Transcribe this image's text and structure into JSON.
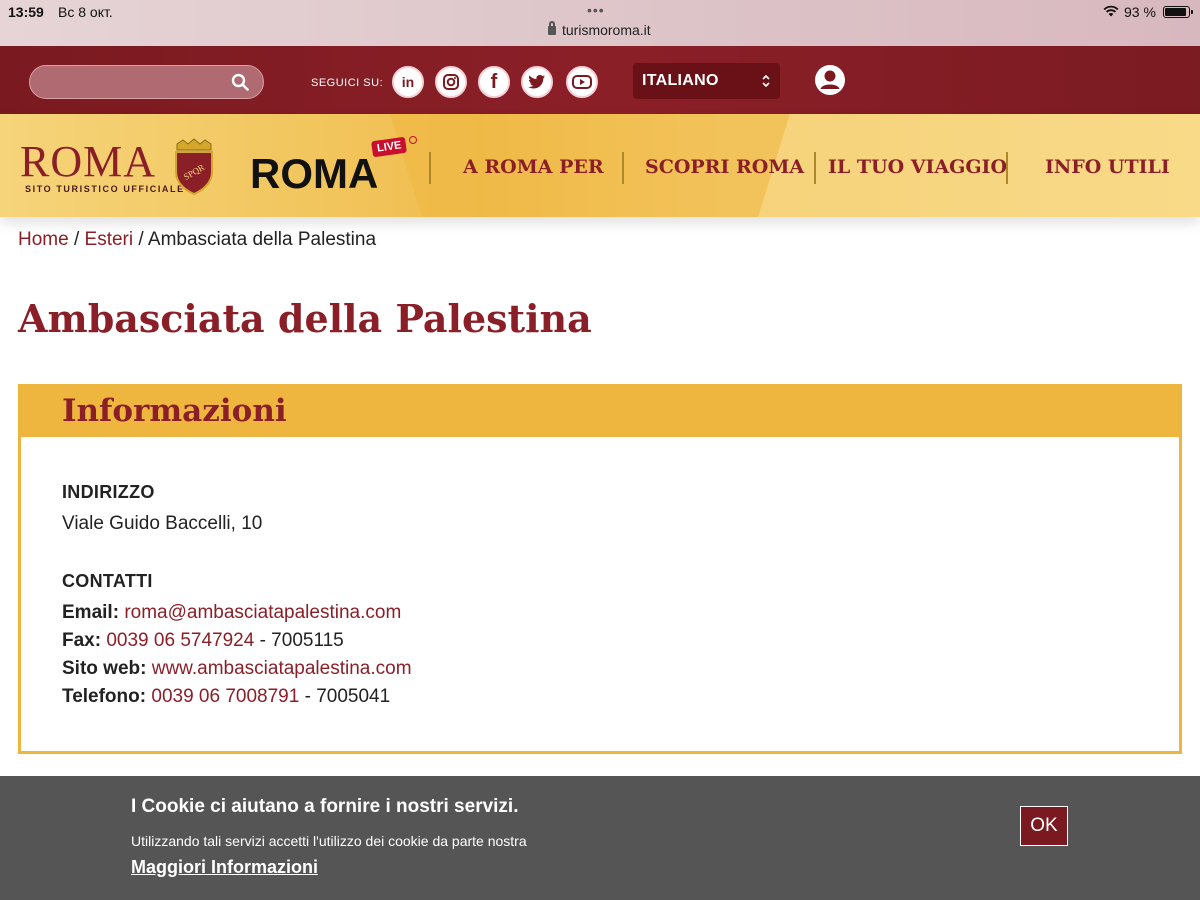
{
  "status_bar": {
    "time": "13:59",
    "date": "Вс 8 окт.",
    "url": "turismoroma.it",
    "battery": "93 %"
  },
  "topbar": {
    "follow_label": "SEGUICI SU:",
    "social": [
      {
        "name": "linkedin-icon",
        "glyph": "in"
      },
      {
        "name": "instagram-icon",
        "glyph": "◎"
      },
      {
        "name": "facebook-icon",
        "glyph": "f"
      },
      {
        "name": "twitter-icon",
        "glyph": "🐦"
      },
      {
        "name": "youtube-icon",
        "glyph": "▶"
      }
    ],
    "language": "ITALIANO"
  },
  "navbar": {
    "logo_text": "ROMA",
    "logo_subtitle": "SITO TURISTICO UFFICIALE",
    "roma_live": "ROMA",
    "live_badge": "LIVE",
    "items": [
      "A ROMA PER",
      "SCOPRI ROMA",
      "IL TUO VIAGGIO",
      "INFO UTILI"
    ]
  },
  "breadcrumb": {
    "home": "Home",
    "sep1": " / ",
    "section": "Esteri",
    "sep2": " / ",
    "current": "Ambasciata della Palestina"
  },
  "page": {
    "title": "Ambasciata della Palestina"
  },
  "info": {
    "heading": "Informazioni",
    "address_label": "INDIRIZZO",
    "address": "Viale Guido Baccelli, 10",
    "contacts_label": "CONTATTI",
    "email_label": "Email:",
    "email": "roma@ambasciatapalestina.com",
    "fax_label": "Fax:",
    "fax": "0039 06 5747924",
    "fax_extra": " - 7005115",
    "web_label": "Sito web:",
    "web": "www.ambasciatapalestina.com",
    "phone_label": "Telefono:",
    "phone": "0039 06 7008791",
    "phone_extra": " - 7005041"
  },
  "cookie": {
    "title": "I Cookie ci aiutano a fornire i nostri servizi.",
    "text": "Utilizzando tali servizi accetti l'utilizzo dei cookie da parte nostra",
    "more": "Maggiori Informazioni",
    "ok": "OK"
  },
  "colors": {
    "brand_red": "#8b1f28",
    "brand_yellow": "#efb63f",
    "cookie_bg": "#555555"
  }
}
